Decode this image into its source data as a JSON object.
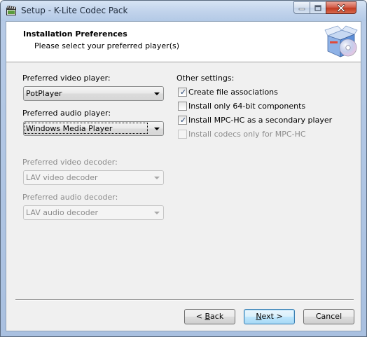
{
  "window": {
    "title": "Setup - K-Lite Codec Pack"
  },
  "header": {
    "title": "Installation Preferences",
    "subtitle": "Please select your preferred player(s)"
  },
  "left": {
    "video_player_label": "Preferred video player:",
    "video_player_value": "PotPlayer",
    "audio_player_label": "Preferred audio player:",
    "audio_player_value": "Windows Media Player",
    "video_decoder_label": "Preferred video decoder:",
    "video_decoder_value": "LAV video decoder",
    "audio_decoder_label": "Preferred audio decoder:",
    "audio_decoder_value": "LAV audio decoder"
  },
  "right": {
    "other_settings_label": "Other settings:",
    "options": [
      {
        "label": "Create file associations",
        "checked": true,
        "enabled": true
      },
      {
        "label": "Install only 64-bit components",
        "checked": false,
        "enabled": true
      },
      {
        "label": "Install MPC-HC as a secondary player",
        "checked": true,
        "enabled": true
      },
      {
        "label": "Install codecs only for MPC-HC",
        "checked": false,
        "enabled": false
      }
    ]
  },
  "buttons": {
    "back": {
      "prefix": "< ",
      "mnemonic": "B",
      "rest": "ack"
    },
    "next": {
      "mnemonic": "N",
      "rest": "ext >"
    },
    "cancel": "Cancel"
  }
}
